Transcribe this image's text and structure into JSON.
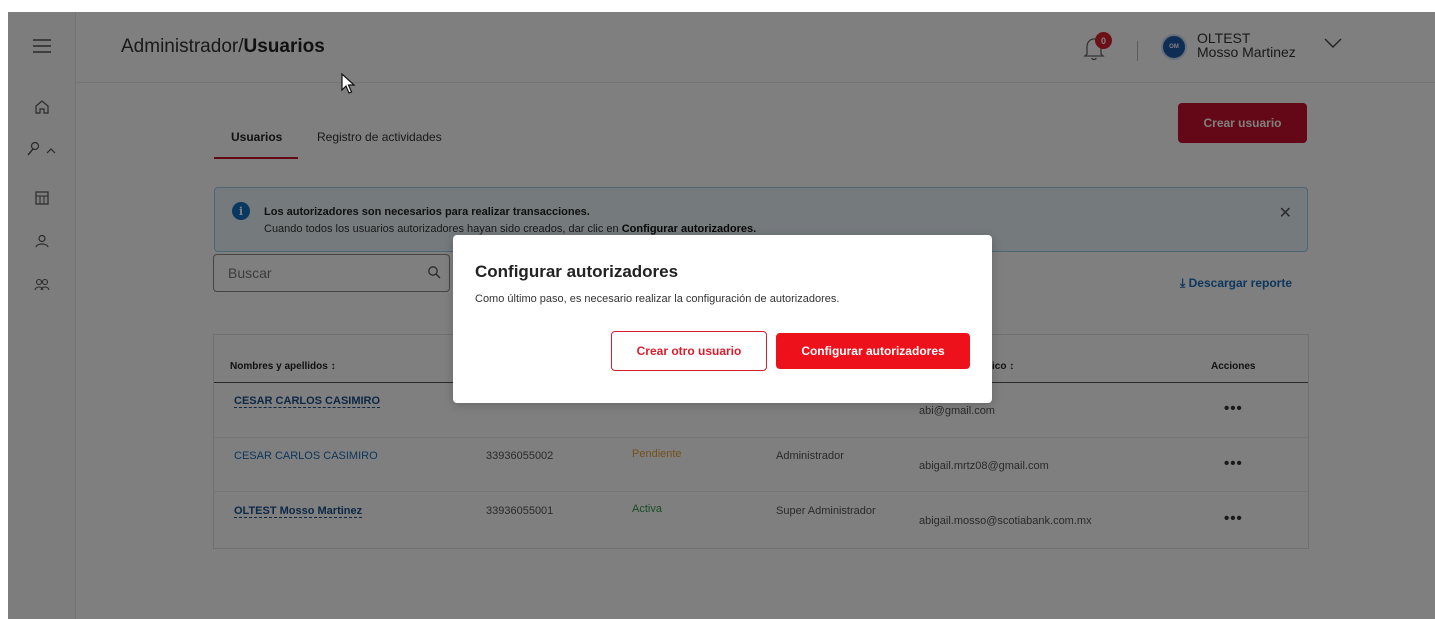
{
  "header": {
    "breadcrumb_prefix": "Administrador/",
    "breadcrumb_current": "Usuarios",
    "notification_count": "0",
    "avatar_initials": "OM",
    "user_first": "OLTEST",
    "user_last": "Mosso Martinez"
  },
  "tabs": {
    "active": "Usuarios",
    "other": "Registro de actividades"
  },
  "create_user_label": "Crear usuario",
  "alert": {
    "title": "Los autorizadores son necesarios para realizar transacciones.",
    "text_prefix": "Cuando todos los usuarios autorizadores hayan sido creados, dar clic en ",
    "text_bold": "Configurar autorizadores."
  },
  "search": {
    "placeholder": "Buscar"
  },
  "download_label": "Descargar reporte",
  "table": {
    "headers": {
      "name": "Nombres y apellidos",
      "email_partial": "ico",
      "actions": "Acciones"
    },
    "rows": [
      {
        "name": "CESAR CARLOS CASIMIRO",
        "id": "",
        "status": "",
        "role": "",
        "email": "abi@gmail.com"
      },
      {
        "name": "CESAR CARLOS CASIMIRO",
        "id": "33936055002",
        "status": "Pendiente",
        "role": "Administrador",
        "email": "abigail.mrtz08@gmail.com"
      },
      {
        "name": "OLTEST Mosso Martinez",
        "id": "33936055001",
        "status": "Activa",
        "role": "Super Administrador",
        "email": "abigail.mosso@scotiabank.com.mx"
      }
    ]
  },
  "modal": {
    "title": "Configurar autorizadores",
    "description": "Como último paso, es necesario realizar la configuración de autorizadores.",
    "secondary_label": "Crear otro usuario",
    "primary_label": "Configurar autorizadores"
  }
}
